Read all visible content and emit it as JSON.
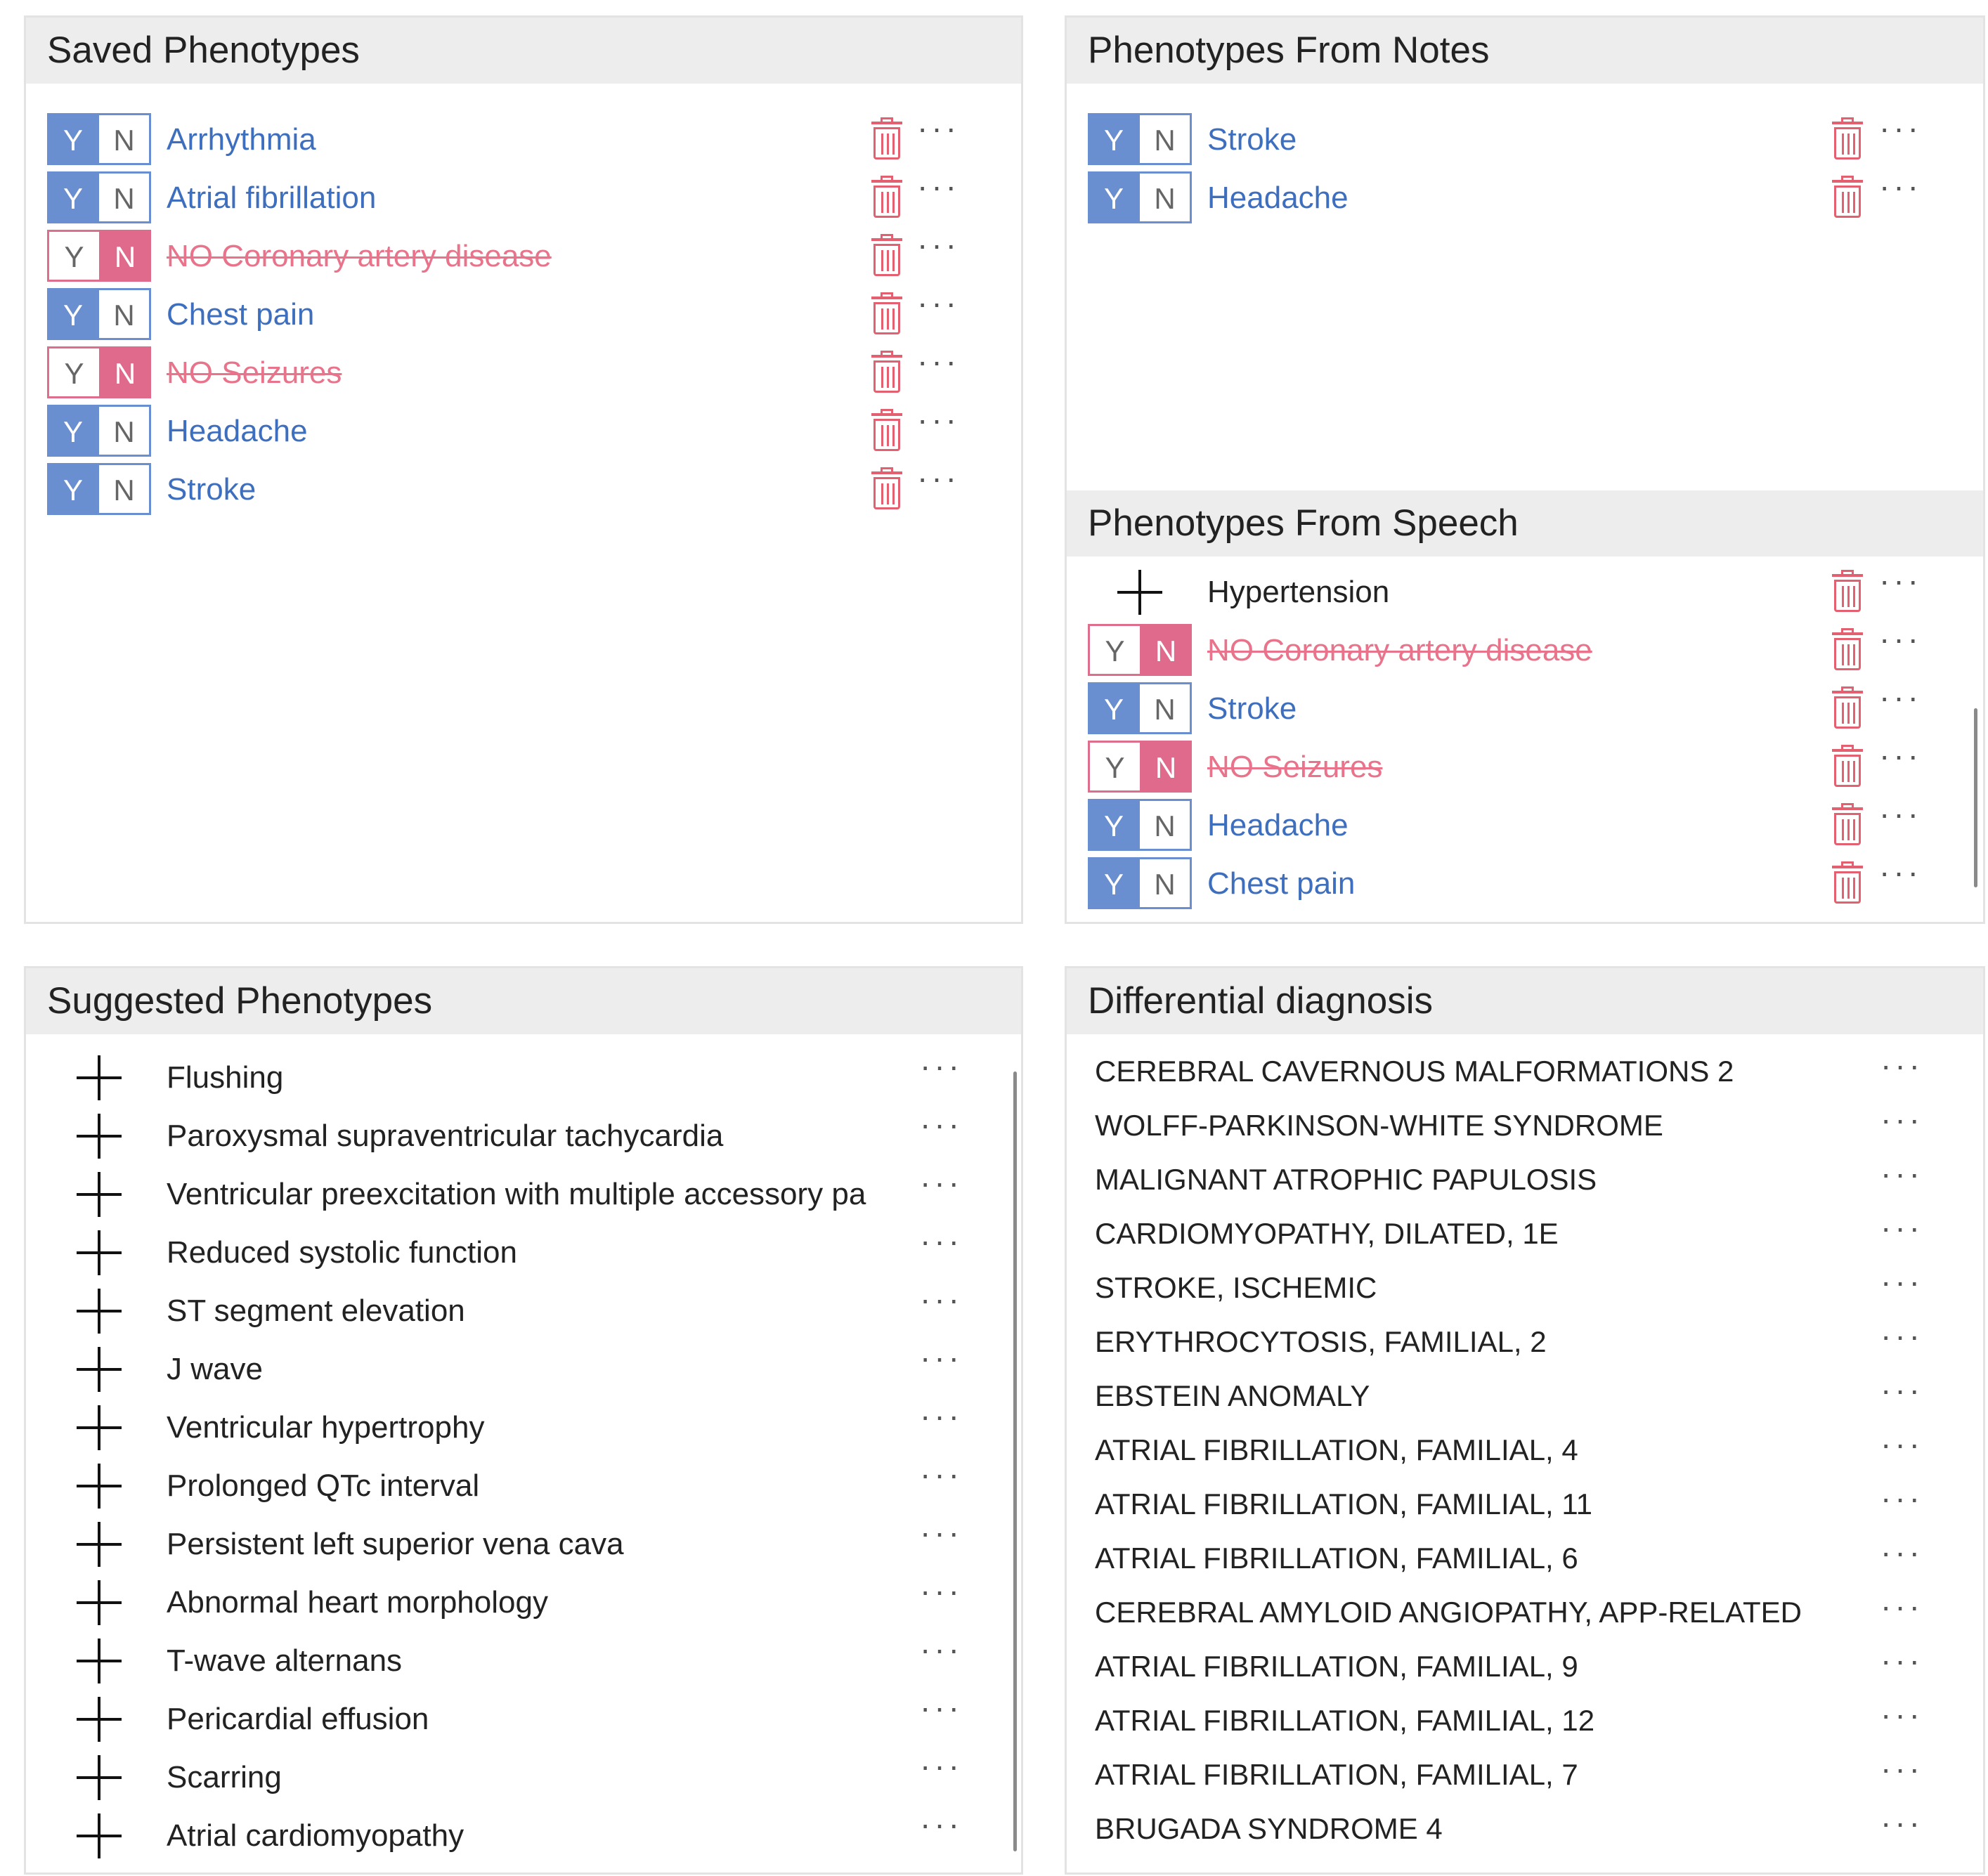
{
  "panels": {
    "saved": {
      "title": "Saved Phenotypes",
      "items": [
        {
          "label": "Arrhythmia",
          "state": "yes"
        },
        {
          "label": "Atrial fibrillation",
          "state": "yes"
        },
        {
          "label": "NO Coronary artery disease",
          "state": "no"
        },
        {
          "label": "Chest pain",
          "state": "yes"
        },
        {
          "label": "NO Seizures",
          "state": "no"
        },
        {
          "label": "Headache",
          "state": "yes"
        },
        {
          "label": "Stroke",
          "state": "yes"
        }
      ]
    },
    "notes": {
      "title": "Phenotypes From Notes",
      "items": [
        {
          "label": "Stroke",
          "state": "yes"
        },
        {
          "label": "Headache",
          "state": "yes"
        }
      ]
    },
    "speech": {
      "title": "Phenotypes From Speech",
      "items": [
        {
          "label": "Hypertension",
          "state": "add"
        },
        {
          "label": "NO Coronary artery disease",
          "state": "no"
        },
        {
          "label": "Stroke",
          "state": "yes"
        },
        {
          "label": "NO Seizures",
          "state": "no"
        },
        {
          "label": "Headache",
          "state": "yes"
        },
        {
          "label": "Chest pain",
          "state": "yes"
        }
      ]
    },
    "suggested": {
      "title": "Suggested Phenotypes",
      "items": [
        "Flushing",
        "Paroxysmal supraventricular tachycardia",
        "Ventricular preexcitation with multiple accessory pa",
        "Reduced systolic function",
        "ST segment elevation",
        "J wave",
        "Ventricular hypertrophy",
        "Prolonged QTc interval",
        "Persistent left superior vena cava",
        "Abnormal heart morphology",
        "T-wave alternans",
        "Pericardial effusion",
        "Scarring",
        "Atrial cardiomyopathy"
      ]
    },
    "differential": {
      "title": "Differential diagnosis",
      "items": [
        "CEREBRAL CAVERNOUS MALFORMATIONS 2",
        "WOLFF-PARKINSON-WHITE SYNDROME",
        "MALIGNANT ATROPHIC PAPULOSIS",
        "CARDIOMYOPATHY, DILATED, 1E",
        "STROKE, ISCHEMIC",
        "ERYTHROCYTOSIS, FAMILIAL, 2",
        "EBSTEIN ANOMALY",
        "ATRIAL FIBRILLATION, FAMILIAL, 4",
        "ATRIAL FIBRILLATION, FAMILIAL, 11",
        "ATRIAL FIBRILLATION, FAMILIAL, 6",
        "CEREBRAL AMYLOID ANGIOPATHY, APP-RELATED",
        "ATRIAL FIBRILLATION, FAMILIAL, 9",
        "ATRIAL FIBRILLATION, FAMILIAL, 12",
        "ATRIAL FIBRILLATION, FAMILIAL, 7",
        "BRUGADA SYNDROME 4"
      ]
    }
  },
  "toggle": {
    "yes_letter": "Y",
    "no_letter": "N"
  },
  "more_glyph": "···",
  "colors": {
    "accent_blue": "#6a8fd0",
    "negated_pink": "#df6a8b",
    "trash_red": "#e2606f",
    "header_bg": "#ededed"
  }
}
